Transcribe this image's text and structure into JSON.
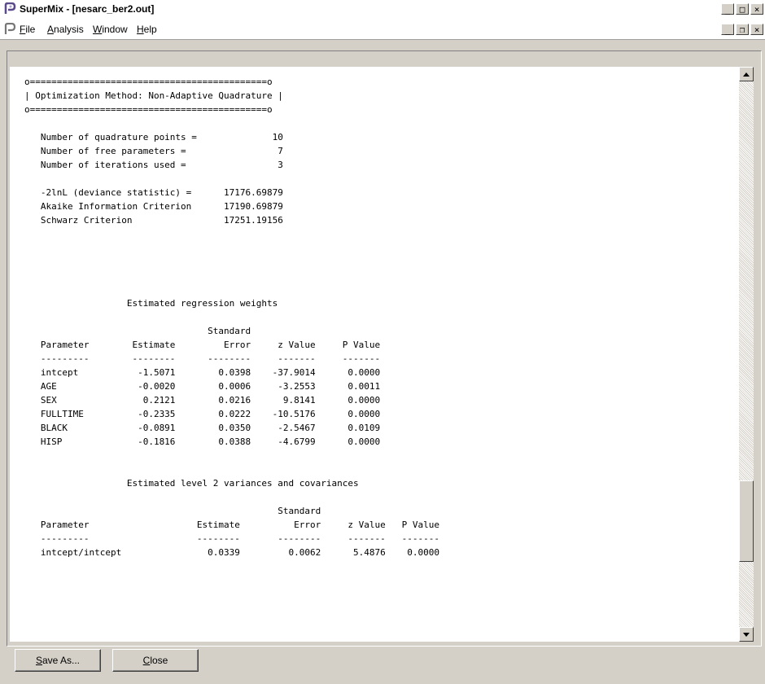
{
  "window": {
    "title": "SuperMix - [nesarc_ber2.out]"
  },
  "menu": [
    {
      "label": "File",
      "key": "F",
      "rest": "ile"
    },
    {
      "label": "Analysis",
      "key": "A",
      "rest": "nalysis"
    },
    {
      "label": "Window",
      "key": "W",
      "rest": "indow"
    },
    {
      "label": "Help",
      "key": "H",
      "rest": "elp"
    }
  ],
  "output_lines": [
    "o============================================o",
    "| Optimization Method: Non-Adaptive Quadrature |",
    "o============================================o",
    "",
    "   Number of quadrature points =              10",
    "   Number of free parameters =                 7",
    "   Number of iterations used =                 3",
    "",
    "   -2lnL (deviance statistic) =      17176.69879",
    "   Akaike Information Criterion      17190.69879",
    "   Schwarz Criterion                 17251.19156",
    "",
    "",
    "",
    "",
    "",
    "                   Estimated regression weights",
    "",
    "                                  Standard",
    "   Parameter        Estimate         Error     z Value     P Value",
    "   ---------        --------      --------     -------     -------",
    "   intcept           -1.5071        0.0398    -37.9014      0.0000",
    "   AGE               -0.0020        0.0006     -3.2553      0.0011",
    "   SEX                0.2121        0.0216      9.8141      0.0000",
    "   FULLTIME          -0.2335        0.0222    -10.5176      0.0000",
    "   BLACK             -0.0891        0.0350     -2.5467      0.0109",
    "   HISP              -0.1816        0.0388     -4.6799      0.0000",
    "",
    "",
    "                   Estimated level 2 variances and covariances",
    "",
    "                                               Standard",
    "   Parameter                    Estimate          Error     z Value   P Value",
    "   ---------                    --------       --------     -------   -------",
    "   intcept/intcept                0.0339         0.0062      5.4876    0.0000"
  ],
  "buttons": {
    "save_as": {
      "label": "Save As...",
      "key": "S",
      "rest": "ave As..."
    },
    "close": {
      "label": "Close",
      "key": "C",
      "rest": "lose"
    }
  },
  "scrollbar": {
    "position_fraction": 0.86
  },
  "colors": {
    "chrome": "#d4d0c8",
    "pane": "#ffffff",
    "text": "#000000"
  }
}
